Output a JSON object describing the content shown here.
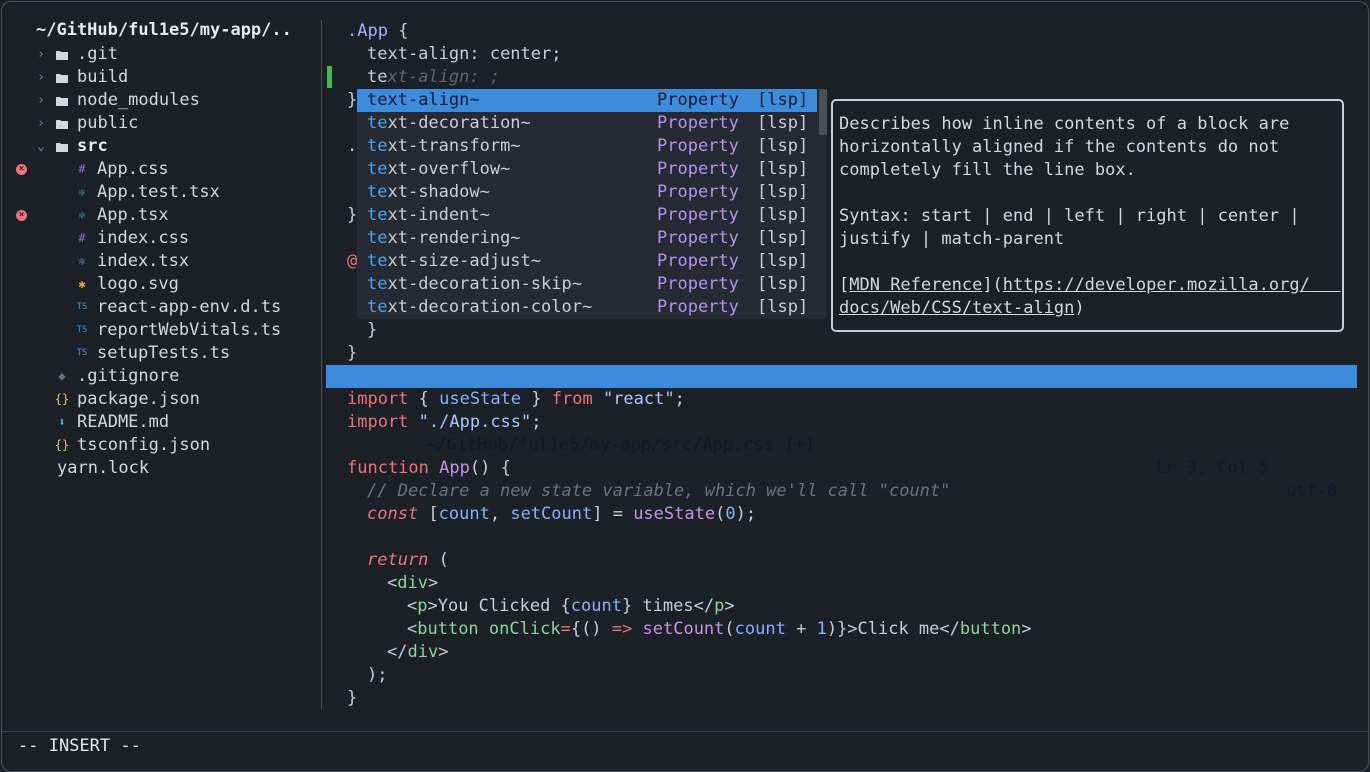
{
  "sidebar": {
    "title": "~/GitHub/ful1e5/my-app/..",
    "items": [
      {
        "label": ".git",
        "icon": "folder-icon",
        "chevron": "›"
      },
      {
        "label": "build",
        "icon": "folder-icon",
        "chevron": "›"
      },
      {
        "label": "node_modules",
        "icon": "folder-icon",
        "chevron": "›"
      },
      {
        "label": "public",
        "icon": "folder-icon",
        "chevron": "›"
      },
      {
        "label": "src",
        "icon": "folder-open-icon",
        "chevron": "⌄"
      },
      {
        "label": "App.css",
        "icon": "css-icon",
        "glyph": "#",
        "error": true
      },
      {
        "label": "App.test.tsx",
        "icon": "react-icon",
        "glyph": "⚛"
      },
      {
        "label": "App.tsx",
        "icon": "react-icon",
        "glyph": "⚛",
        "error": true
      },
      {
        "label": "index.css",
        "icon": "css-icon",
        "glyph": "#"
      },
      {
        "label": "index.tsx",
        "icon": "react-icon",
        "glyph": "⚛"
      },
      {
        "label": "logo.svg",
        "icon": "svg-icon",
        "glyph": "✱"
      },
      {
        "label": "react-app-env.d.ts",
        "icon": "typescript-icon",
        "glyph": "TS"
      },
      {
        "label": "reportWebVitals.ts",
        "icon": "typescript-icon",
        "glyph": "TS"
      },
      {
        "label": "setupTests.ts",
        "icon": "typescript-icon",
        "glyph": "TS"
      },
      {
        "label": ".gitignore",
        "icon": "git-icon",
        "glyph": "◆"
      },
      {
        "label": "package.json",
        "icon": "json-icon",
        "glyph": "{}"
      },
      {
        "label": "README.md",
        "icon": "markdown-icon",
        "glyph": "⬇"
      },
      {
        "label": "tsconfig.json",
        "icon": "json-icon",
        "glyph": "{}"
      },
      {
        "label": "yarn.lock",
        "icon": "",
        "glyph": ""
      }
    ]
  },
  "css_buffer": {
    "line1_selector": ".App",
    "line1_brace": " {",
    "line2_prop": "text-align",
    "line2_value": ": center;",
    "line3_typed": "te",
    "line3_ghost": "xt-align: ;",
    "closing_brace": "}",
    "partial_lines": [
      ".",
      "}",
      "@"
    ],
    "inner_brace": "}",
    "last_brace": "}"
  },
  "completion": {
    "items": [
      {
        "match": "te",
        "rest": "xt-align~",
        "kind": "Property",
        "source": "[lsp]",
        "selected": true
      },
      {
        "match": "te",
        "rest": "xt-decoration~",
        "kind": "Property",
        "source": "[lsp]"
      },
      {
        "match": "te",
        "rest": "xt-transform~",
        "kind": "Property",
        "source": "[lsp]"
      },
      {
        "match": "te",
        "rest": "xt-overflow~",
        "kind": "Property",
        "source": "[lsp]"
      },
      {
        "match": "te",
        "rest": "xt-shadow~",
        "kind": "Property",
        "source": "[lsp]"
      },
      {
        "match": "te",
        "rest": "xt-indent~",
        "kind": "Property",
        "source": "[lsp]"
      },
      {
        "match": "te",
        "rest": "xt-rendering~",
        "kind": "Property",
        "source": "[lsp]"
      },
      {
        "match": "te",
        "rest": "xt-size-adjust~",
        "kind": "Property",
        "source": "[lsp]"
      },
      {
        "match": "te",
        "rest": "xt-decoration-skip~",
        "kind": "Property",
        "source": "[lsp]"
      },
      {
        "match": "te",
        "rest": "xt-decoration-color~",
        "kind": "Property",
        "source": "[lsp]"
      }
    ]
  },
  "doc": {
    "lines": [
      "Describes how inline contents of a block are",
      "horizontally aligned if the contents do not",
      "completely fill the line box.",
      "",
      "Syntax: start | end | left | right | center |",
      "justify | match-parent",
      ""
    ],
    "link_open": "[",
    "link_text": "MDN Reference",
    "link_mid": "](",
    "link_url1": "https://developer.mozilla.org/",
    "link_url2": "docs/Web/CSS/text-align",
    "link_close": ")"
  },
  "statusbar": {
    "branch_icon": "⎇",
    "branch": "main",
    "path": "~/GitHub/ful1e5/my-app/src/App.css [+]",
    "position": "Ln 3, Col 5",
    "encoding": "utf-8"
  },
  "tsx_buffer": {
    "l1": [
      "import",
      " { ",
      "useState",
      " } ",
      "from",
      " ",
      "\"react\"",
      ";"
    ],
    "l2": [
      "import",
      " ",
      "\"./App.css\"",
      ";"
    ],
    "l4": [
      "function",
      " ",
      "App",
      "() {"
    ],
    "l5": "// Declare a new state variable, which we'll call \"count\"",
    "l6": [
      "const",
      " [",
      "count",
      ", ",
      "setCount",
      "] = ",
      "useState",
      "(",
      "0",
      ");"
    ],
    "l8": [
      "return",
      " ("
    ],
    "l9": [
      "<",
      "div",
      ">"
    ],
    "l10": [
      "<",
      "p",
      ">You Clicked {",
      "count",
      "} times</",
      "p",
      ">"
    ],
    "l11": [
      "<",
      "button",
      " ",
      "onClick",
      "=",
      "{() ",
      "=>",
      " ",
      "setCount",
      "(",
      "count",
      " + ",
      "1",
      ")}>Click me</",
      "button",
      ">"
    ],
    "l12": [
      "</",
      "div",
      ">"
    ],
    "l13": ");",
    "l14": "}"
  },
  "cmdline": {
    "mode": "-- INSERT --"
  }
}
